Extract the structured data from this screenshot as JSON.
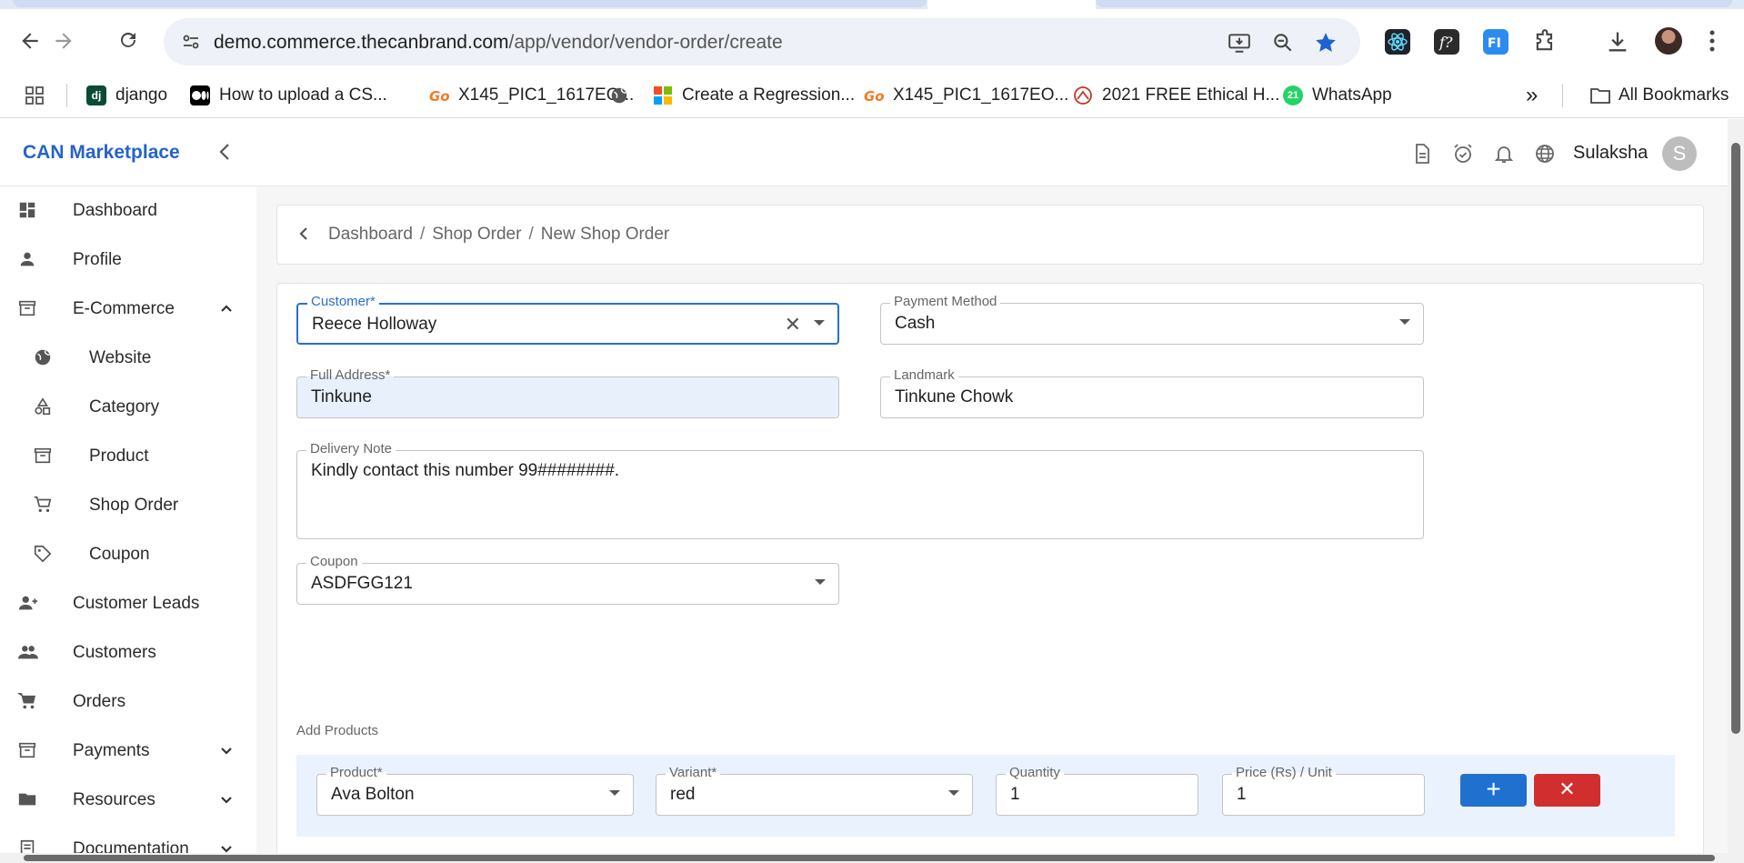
{
  "browser": {
    "url_host": "demo.commerce.thecanbrand.com",
    "url_path": "/app/vendor/vendor-order/create",
    "bookmarks": [
      {
        "label": "django",
        "icon": "django-icon"
      },
      {
        "label": "How to upload a CS...",
        "icon": "medium-icon"
      },
      {
        "label": "X145_PIC1_1617EO...",
        "icon": "go-icon"
      },
      {
        "label": "",
        "icon": "globe-icon"
      },
      {
        "label": "Create a Regression...",
        "icon": "microsoft-icon"
      },
      {
        "label": "X145_PIC1_1617EO...",
        "icon": "go-icon"
      },
      {
        "label": "2021 FREE Ethical H...",
        "icon": "hacker-icon"
      },
      {
        "label": "WhatsApp",
        "icon": "whatsapp-icon"
      }
    ],
    "more_label": "»",
    "all_bookmarks": "All Bookmarks"
  },
  "app": {
    "brand": "CAN Marketplace",
    "user_name": "Sulaksha",
    "avatar_letter": "S"
  },
  "sidebar": {
    "items": [
      {
        "label": "Dashboard"
      },
      {
        "label": "Profile"
      },
      {
        "label": "E-Commerce"
      },
      {
        "label": "Website"
      },
      {
        "label": "Category"
      },
      {
        "label": "Product"
      },
      {
        "label": "Shop Order"
      },
      {
        "label": "Coupon"
      },
      {
        "label": "Customer Leads"
      },
      {
        "label": "Customers"
      },
      {
        "label": "Orders"
      },
      {
        "label": "Payments"
      },
      {
        "label": "Resources"
      },
      {
        "label": "Documentation"
      }
    ]
  },
  "breadcrumb": {
    "items": [
      "Dashboard",
      "Shop Order",
      "New Shop Order"
    ],
    "separator": "/"
  },
  "form": {
    "customer": {
      "label": "Customer*",
      "value": "Reece Holloway"
    },
    "payment_method": {
      "label": "Payment Method",
      "value": "Cash"
    },
    "full_address": {
      "label": "Full Address*",
      "value": "Tinkune"
    },
    "landmark": {
      "label": "Landmark",
      "value": "Tinkune Chowk"
    },
    "delivery_note": {
      "label": "Delivery Note",
      "value": "Kindly contact this number 99########."
    },
    "coupon": {
      "label": "Coupon",
      "value": "ASDFGG121"
    },
    "add_products_label": "Add Products",
    "product_row": {
      "product": {
        "label": "Product*",
        "value": "Ava Bolton"
      },
      "variant": {
        "label": "Variant*",
        "value": "red"
      },
      "quantity": {
        "label": "Quantity",
        "value": "1"
      },
      "price": {
        "label": "Price (Rs) / Unit",
        "value": "1"
      },
      "add_symbol": "+",
      "remove_symbol": "✕"
    }
  },
  "colors": {
    "brand": "#2563c9",
    "focus": "#2a6ed4",
    "add_button": "#2070d0",
    "remove_button": "#d12f2f"
  }
}
